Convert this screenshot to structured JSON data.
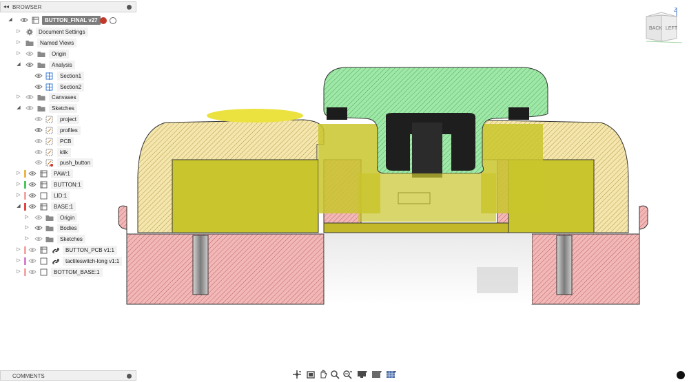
{
  "browser": {
    "title": "BROWSER",
    "root": {
      "label": "BUTTON_FINAL v27"
    },
    "items": [
      {
        "label": "Document Settings"
      },
      {
        "label": "Named Views"
      },
      {
        "label": "Origin"
      },
      {
        "label": "Analysis"
      },
      {
        "label": "Section1"
      },
      {
        "label": "Section2"
      },
      {
        "label": "Canvases"
      },
      {
        "label": "Sketches"
      },
      {
        "label": "project"
      },
      {
        "label": "profiles"
      },
      {
        "label": "PCB"
      },
      {
        "label": "klik"
      },
      {
        "label": "push_button"
      },
      {
        "label": "PAW:1"
      },
      {
        "label": "BUTTON:1"
      },
      {
        "label": "LID:1"
      },
      {
        "label": "BASE:1"
      },
      {
        "label": "Origin"
      },
      {
        "label": "Bodies"
      },
      {
        "label": "Sketches"
      },
      {
        "label": "BUTTON_PCB v1:1"
      },
      {
        "label": "tactileswitch-long v1:1"
      },
      {
        "label": "BOTTOM_BASE:1"
      }
    ]
  },
  "comments": {
    "title": "COMMENTS"
  },
  "viewcube": {
    "back_label": "BACK",
    "left_label": "LEFT",
    "axis_label": "Z"
  },
  "colors": {
    "base_section": "#f0b3b3",
    "lid_section": "#f3e4a8",
    "button_section": "#9ee6a6",
    "paw_section": "#c8c52a",
    "hatch": "#9a3d3d"
  },
  "toolbar": {
    "icons": [
      "orbit-icon",
      "pan-icon",
      "look-at-icon",
      "zoom-icon",
      "fit-icon",
      "display-settings-icon",
      "visual-style-icon",
      "grid-icon"
    ]
  }
}
